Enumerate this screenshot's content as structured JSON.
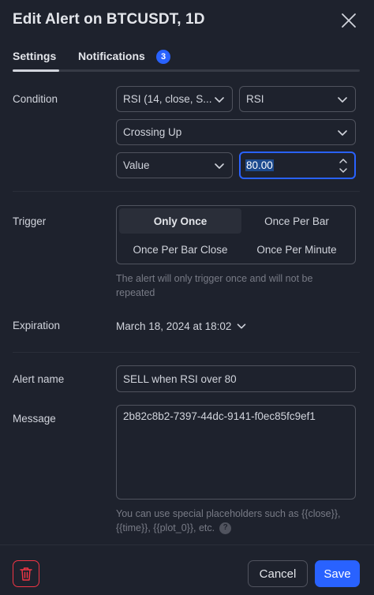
{
  "dialog": {
    "title": "Edit Alert on BTCUSDT, 1D"
  },
  "tabs": [
    {
      "label": "Settings"
    },
    {
      "label": "Notifications",
      "badge": "3"
    }
  ],
  "condition": {
    "label": "Condition",
    "source": "RSI (14, close, S...",
    "plot": "RSI",
    "operator": "Crossing Up",
    "compare_type": "Value",
    "value": "80.00"
  },
  "trigger": {
    "label": "Trigger",
    "options": [
      "Only Once",
      "Once Per Bar",
      "Once Per Bar Close",
      "Once Per Minute"
    ],
    "selected": "Only Once",
    "hint": "The alert will only trigger once and will not be repeated"
  },
  "expiration": {
    "label": "Expiration",
    "value": "March 18, 2024 at 18:02"
  },
  "alert_name": {
    "label": "Alert name",
    "value": "SELL when RSI over 80"
  },
  "message": {
    "label": "Message",
    "value": "2b82c8b2-7397-44dc-9141-f0ec85fc9ef1",
    "hint_line1": "You can use special placeholders such as {{close}},",
    "hint_line2": "{{time}}, {{plot_0}}, etc."
  },
  "footer": {
    "cancel_label": "Cancel",
    "save_label": "Save"
  },
  "colors": {
    "background": "#1e222d",
    "accent": "#2962ff",
    "danger": "#f23645",
    "border": "#50535e"
  },
  "icons": [
    "close-icon",
    "chevron-down-icon",
    "stepper-icon",
    "trash-icon",
    "help-icon"
  ]
}
